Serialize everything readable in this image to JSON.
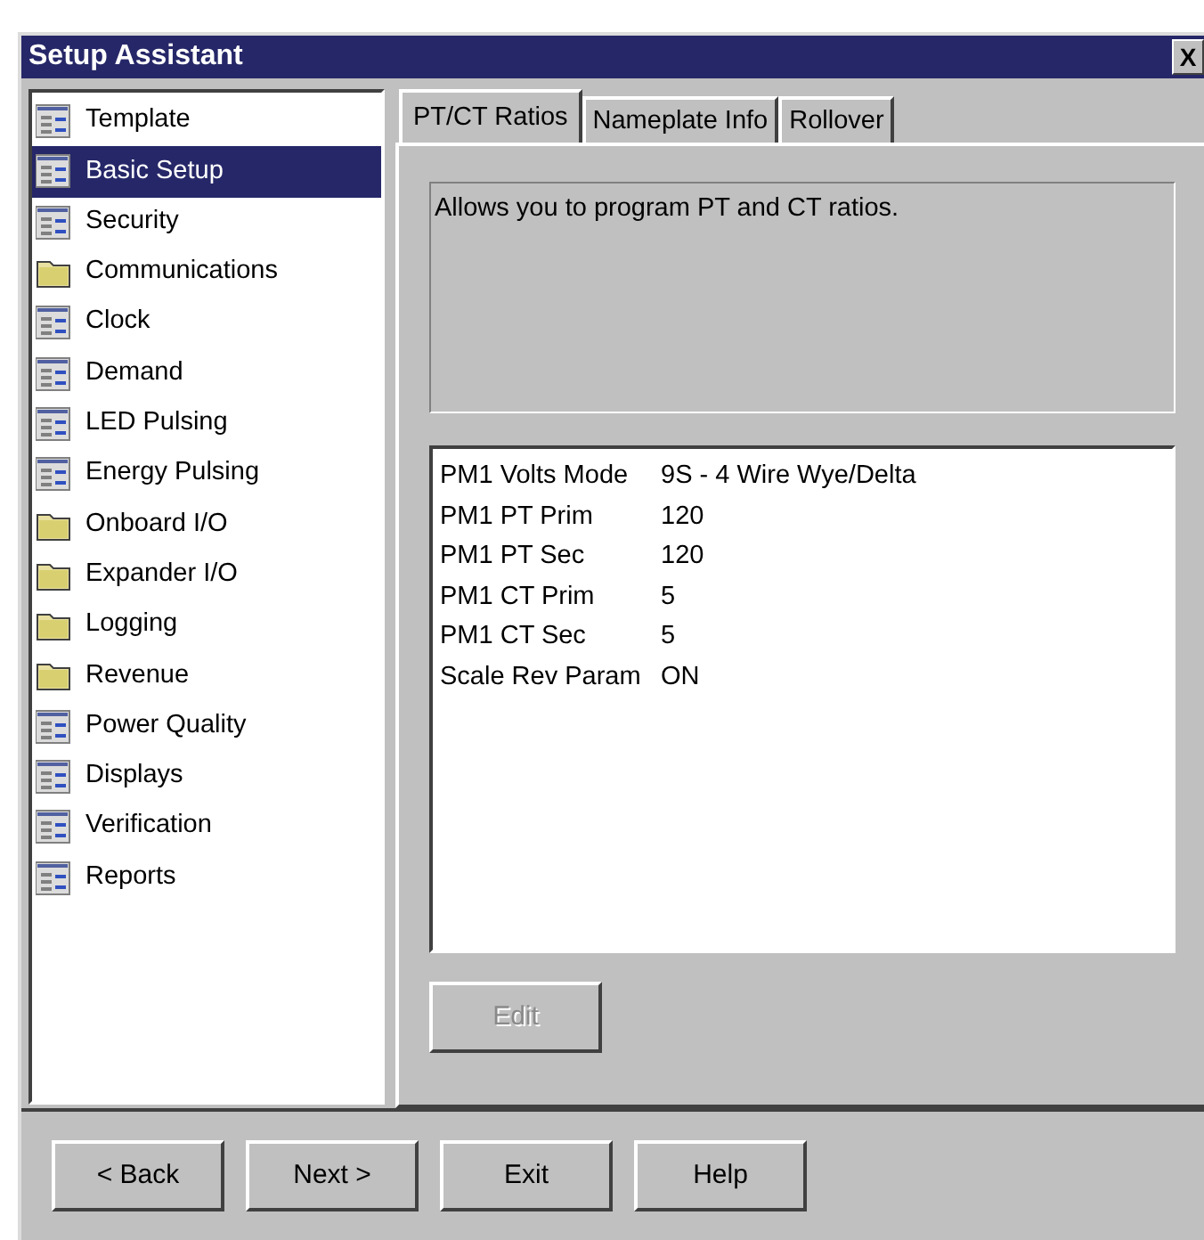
{
  "window": {
    "title": "Setup Assistant",
    "close": "X"
  },
  "sidebar": {
    "items": [
      {
        "label": "Template",
        "kind": "page",
        "selected": false
      },
      {
        "label": "Basic Setup",
        "kind": "page",
        "selected": true
      },
      {
        "label": "Security",
        "kind": "page",
        "selected": false
      },
      {
        "label": "Communications",
        "kind": "folder",
        "selected": false
      },
      {
        "label": "Clock",
        "kind": "page",
        "selected": false
      },
      {
        "label": "Demand",
        "kind": "page",
        "selected": false
      },
      {
        "label": "LED Pulsing",
        "kind": "page",
        "selected": false
      },
      {
        "label": "Energy Pulsing",
        "kind": "page",
        "selected": false
      },
      {
        "label": "Onboard I/O",
        "kind": "folder",
        "selected": false
      },
      {
        "label": "Expander I/O",
        "kind": "folder",
        "selected": false
      },
      {
        "label": "Logging",
        "kind": "folder",
        "selected": false
      },
      {
        "label": "Revenue",
        "kind": "folder",
        "selected": false
      },
      {
        "label": "Power Quality",
        "kind": "page",
        "selected": false
      },
      {
        "label": "Displays",
        "kind": "page",
        "selected": false
      },
      {
        "label": "Verification",
        "kind": "page",
        "selected": false
      },
      {
        "label": "Reports",
        "kind": "page",
        "selected": false
      }
    ]
  },
  "tabs": [
    {
      "label": "PT/CT Ratios",
      "selected": true
    },
    {
      "label": "Nameplate Info",
      "selected": false
    },
    {
      "label": "Rollover",
      "selected": false
    }
  ],
  "description": "Allows you to program PT and CT ratios.",
  "settings": [
    {
      "name": "PM1 Volts Mode",
      "value": "9S - 4 Wire Wye/Delta"
    },
    {
      "name": "PM1 PT Prim",
      "value": "120"
    },
    {
      "name": "PM1 PT Sec",
      "value": "120"
    },
    {
      "name": "PM1 CT Prim",
      "value": "5"
    },
    {
      "name": "PM1 CT Sec",
      "value": "5"
    },
    {
      "name": "Scale Rev Param",
      "value": "ON"
    }
  ],
  "edit_button": {
    "label": "Edit",
    "disabled": true
  },
  "buttons": [
    "< Back",
    "Next >",
    "Exit",
    "Help"
  ]
}
